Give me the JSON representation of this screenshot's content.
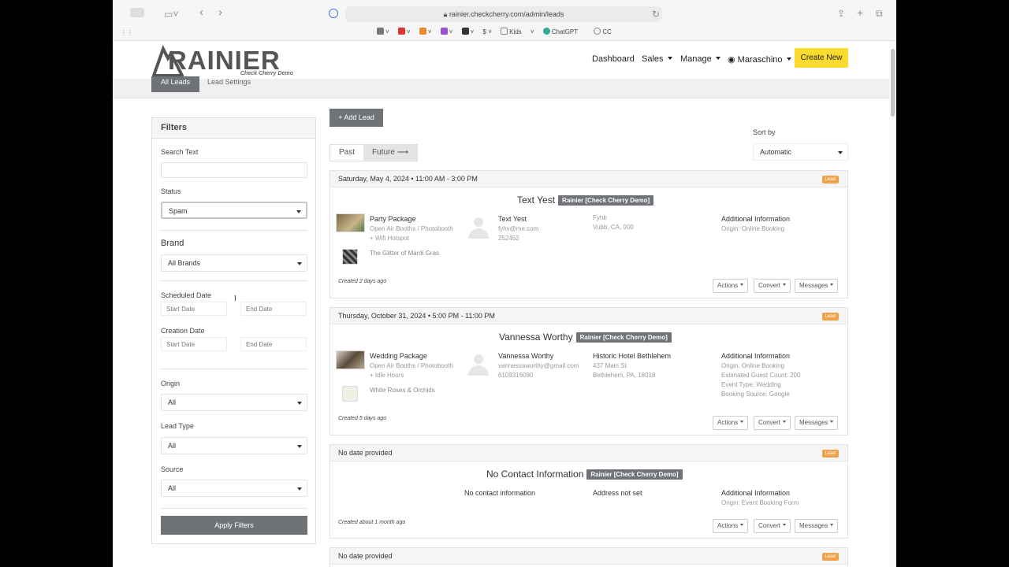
{
  "browser": {
    "url": "rainier.checkcherry.com/admin/leads",
    "bookmarks": [
      "Kids",
      "ChatGPT",
      "CC"
    ]
  },
  "header": {
    "logo_text": "RAINIER",
    "logo_sub": "Check Cherry Demo",
    "nav": [
      "Dashboard",
      "Sales",
      "Manage",
      "Maraschino"
    ],
    "create_label": "Create New"
  },
  "subnav": {
    "active": "All Leads",
    "other": "Lead Settings"
  },
  "filters": {
    "title": "Filters",
    "search_label": "Search Text",
    "status_label": "Status",
    "status_value": "Spam",
    "brand_title": "Brand",
    "brand_value": "All Brands",
    "scheduled_label": "Scheduled Date",
    "creation_label": "Creation Date",
    "start_placeholder": "Start Date",
    "end_placeholder": "End Date",
    "origin_label": "Origin",
    "origin_value": "All",
    "leadtype_label": "Lead Type",
    "leadtype_value": "All",
    "source_label": "Source",
    "source_value": "All",
    "apply_label": "Apply Filters"
  },
  "main": {
    "add_lead": "Add Lead",
    "past_label": "Past",
    "future_label": "Future",
    "sort_label": "Sort by",
    "sort_value": "Automatic",
    "actions_label": "Actions",
    "convert_label": "Convert",
    "messages_label": "Messages",
    "lead_badge": "Lead",
    "additional_info": "Additional Information"
  },
  "leads": [
    {
      "date": "Saturday, May 4, 2024 • 11:00 AM - 3:00 PM",
      "name": "Text Yest",
      "brand": "Rainier [Check Cherry Demo]",
      "package": "Party Package",
      "package_lines": [
        "Open Air Booths / Photobooth",
        "+ Wifi Hotspot"
      ],
      "item": "The Glitter of Mardi Gras",
      "contact_name": "Text Yest",
      "contact_lines": [
        "fyhv@me.com",
        "252452"
      ],
      "venue_lines": [
        "Fyhb",
        "Vubb, CA, 000"
      ],
      "info_lines": [
        "Origin: Online Booking"
      ],
      "created": "Created 2 days ago"
    },
    {
      "date": "Thursday, October 31, 2024 • 5:00 PM - 11:00 PM",
      "name": "Vannessa Worthy",
      "brand": "Rainier [Check Cherry Demo]",
      "package": "Wedding Package",
      "package_lines": [
        "Open Air Booths / Photobooth",
        "+ Idle Hours"
      ],
      "item": "White Roses & Orchids",
      "contact_name": "Vannessa Worthy",
      "contact_lines": [
        "vannessaworthy@gmail.com",
        "6109316090"
      ],
      "venue_name": "Historic Hotel Bethlehem",
      "venue_lines": [
        "437 Main St",
        "Bethlehem, PA, 18018"
      ],
      "info_lines": [
        "Origin: Online Booking",
        "Estimated Guest Count: 200",
        "Event Type: Wedding",
        "Booking Source: Google"
      ],
      "created": "Created 5 days ago"
    },
    {
      "date": "No date provided",
      "name": "No Contact Information",
      "brand": "Rainier [Check Cherry Demo]",
      "contact_note": "No contact information",
      "address_note": "Address not set",
      "info_lines": [
        "Origin: Event Booking Form"
      ],
      "created": "Created about 1 month ago"
    },
    {
      "date": "No date provided"
    }
  ],
  "colors": {
    "accent": "#fbdc2e",
    "lead_badge": "#f0a24a",
    "tag": "#6f7378"
  }
}
